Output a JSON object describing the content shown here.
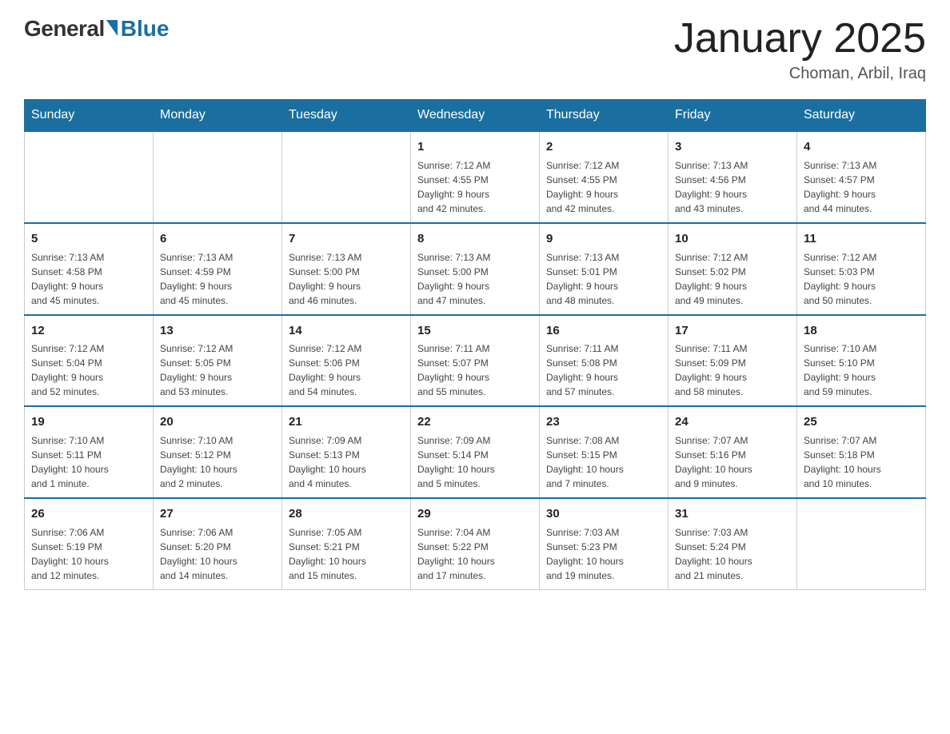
{
  "header": {
    "logo_general": "General",
    "logo_blue": "Blue",
    "title": "January 2025",
    "subtitle": "Choman, Arbil, Iraq"
  },
  "weekdays": [
    "Sunday",
    "Monday",
    "Tuesday",
    "Wednesday",
    "Thursday",
    "Friday",
    "Saturday"
  ],
  "weeks": [
    [
      {
        "day": "",
        "info": ""
      },
      {
        "day": "",
        "info": ""
      },
      {
        "day": "",
        "info": ""
      },
      {
        "day": "1",
        "info": "Sunrise: 7:12 AM\nSunset: 4:55 PM\nDaylight: 9 hours\nand 42 minutes."
      },
      {
        "day": "2",
        "info": "Sunrise: 7:12 AM\nSunset: 4:55 PM\nDaylight: 9 hours\nand 42 minutes."
      },
      {
        "day": "3",
        "info": "Sunrise: 7:13 AM\nSunset: 4:56 PM\nDaylight: 9 hours\nand 43 minutes."
      },
      {
        "day": "4",
        "info": "Sunrise: 7:13 AM\nSunset: 4:57 PM\nDaylight: 9 hours\nand 44 minutes."
      }
    ],
    [
      {
        "day": "5",
        "info": "Sunrise: 7:13 AM\nSunset: 4:58 PM\nDaylight: 9 hours\nand 45 minutes."
      },
      {
        "day": "6",
        "info": "Sunrise: 7:13 AM\nSunset: 4:59 PM\nDaylight: 9 hours\nand 45 minutes."
      },
      {
        "day": "7",
        "info": "Sunrise: 7:13 AM\nSunset: 5:00 PM\nDaylight: 9 hours\nand 46 minutes."
      },
      {
        "day": "8",
        "info": "Sunrise: 7:13 AM\nSunset: 5:00 PM\nDaylight: 9 hours\nand 47 minutes."
      },
      {
        "day": "9",
        "info": "Sunrise: 7:13 AM\nSunset: 5:01 PM\nDaylight: 9 hours\nand 48 minutes."
      },
      {
        "day": "10",
        "info": "Sunrise: 7:12 AM\nSunset: 5:02 PM\nDaylight: 9 hours\nand 49 minutes."
      },
      {
        "day": "11",
        "info": "Sunrise: 7:12 AM\nSunset: 5:03 PM\nDaylight: 9 hours\nand 50 minutes."
      }
    ],
    [
      {
        "day": "12",
        "info": "Sunrise: 7:12 AM\nSunset: 5:04 PM\nDaylight: 9 hours\nand 52 minutes."
      },
      {
        "day": "13",
        "info": "Sunrise: 7:12 AM\nSunset: 5:05 PM\nDaylight: 9 hours\nand 53 minutes."
      },
      {
        "day": "14",
        "info": "Sunrise: 7:12 AM\nSunset: 5:06 PM\nDaylight: 9 hours\nand 54 minutes."
      },
      {
        "day": "15",
        "info": "Sunrise: 7:11 AM\nSunset: 5:07 PM\nDaylight: 9 hours\nand 55 minutes."
      },
      {
        "day": "16",
        "info": "Sunrise: 7:11 AM\nSunset: 5:08 PM\nDaylight: 9 hours\nand 57 minutes."
      },
      {
        "day": "17",
        "info": "Sunrise: 7:11 AM\nSunset: 5:09 PM\nDaylight: 9 hours\nand 58 minutes."
      },
      {
        "day": "18",
        "info": "Sunrise: 7:10 AM\nSunset: 5:10 PM\nDaylight: 9 hours\nand 59 minutes."
      }
    ],
    [
      {
        "day": "19",
        "info": "Sunrise: 7:10 AM\nSunset: 5:11 PM\nDaylight: 10 hours\nand 1 minute."
      },
      {
        "day": "20",
        "info": "Sunrise: 7:10 AM\nSunset: 5:12 PM\nDaylight: 10 hours\nand 2 minutes."
      },
      {
        "day": "21",
        "info": "Sunrise: 7:09 AM\nSunset: 5:13 PM\nDaylight: 10 hours\nand 4 minutes."
      },
      {
        "day": "22",
        "info": "Sunrise: 7:09 AM\nSunset: 5:14 PM\nDaylight: 10 hours\nand 5 minutes."
      },
      {
        "day": "23",
        "info": "Sunrise: 7:08 AM\nSunset: 5:15 PM\nDaylight: 10 hours\nand 7 minutes."
      },
      {
        "day": "24",
        "info": "Sunrise: 7:07 AM\nSunset: 5:16 PM\nDaylight: 10 hours\nand 9 minutes."
      },
      {
        "day": "25",
        "info": "Sunrise: 7:07 AM\nSunset: 5:18 PM\nDaylight: 10 hours\nand 10 minutes."
      }
    ],
    [
      {
        "day": "26",
        "info": "Sunrise: 7:06 AM\nSunset: 5:19 PM\nDaylight: 10 hours\nand 12 minutes."
      },
      {
        "day": "27",
        "info": "Sunrise: 7:06 AM\nSunset: 5:20 PM\nDaylight: 10 hours\nand 14 minutes."
      },
      {
        "day": "28",
        "info": "Sunrise: 7:05 AM\nSunset: 5:21 PM\nDaylight: 10 hours\nand 15 minutes."
      },
      {
        "day": "29",
        "info": "Sunrise: 7:04 AM\nSunset: 5:22 PM\nDaylight: 10 hours\nand 17 minutes."
      },
      {
        "day": "30",
        "info": "Sunrise: 7:03 AM\nSunset: 5:23 PM\nDaylight: 10 hours\nand 19 minutes."
      },
      {
        "day": "31",
        "info": "Sunrise: 7:03 AM\nSunset: 5:24 PM\nDaylight: 10 hours\nand 21 minutes."
      },
      {
        "day": "",
        "info": ""
      }
    ]
  ]
}
